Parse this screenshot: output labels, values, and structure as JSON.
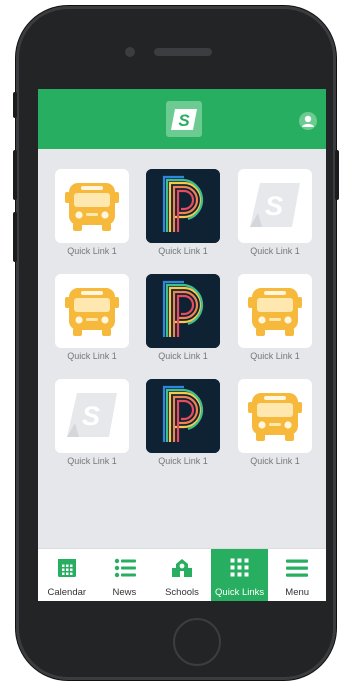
{
  "app": {
    "logo_letter": "S",
    "colors": {
      "brand_green": "#27ae60",
      "screen_bg": "#e5e7eb",
      "bus_yellow": "#f6b93b"
    }
  },
  "quick_links": [
    {
      "label": "Quick Link 1",
      "icon": "school-bus-icon"
    },
    {
      "label": "Quick Link 1",
      "icon": "powerschool-logo-icon"
    },
    {
      "label": "Quick Link 1",
      "icon": "schoolmessenger-logo-icon"
    },
    {
      "label": "Quick Link 1",
      "icon": "school-bus-icon"
    },
    {
      "label": "Quick Link 1",
      "icon": "powerschool-logo-icon"
    },
    {
      "label": "Quick Link 1",
      "icon": "school-bus-icon"
    },
    {
      "label": "Quick Link 1",
      "icon": "schoolmessenger-logo-icon"
    },
    {
      "label": "Quick Link 1",
      "icon": "powerschool-logo-icon"
    },
    {
      "label": "Quick Link 1",
      "icon": "school-bus-icon"
    }
  ],
  "tabs": [
    {
      "label": "Calendar",
      "icon": "calendar-icon",
      "active": false
    },
    {
      "label": "News",
      "icon": "list-icon",
      "active": false
    },
    {
      "label": "Schools",
      "icon": "school-icon",
      "active": false
    },
    {
      "label": "Quick Links",
      "icon": "grid-icon",
      "active": true
    },
    {
      "label": "Menu",
      "icon": "hamburger-menu-icon",
      "active": false
    }
  ]
}
